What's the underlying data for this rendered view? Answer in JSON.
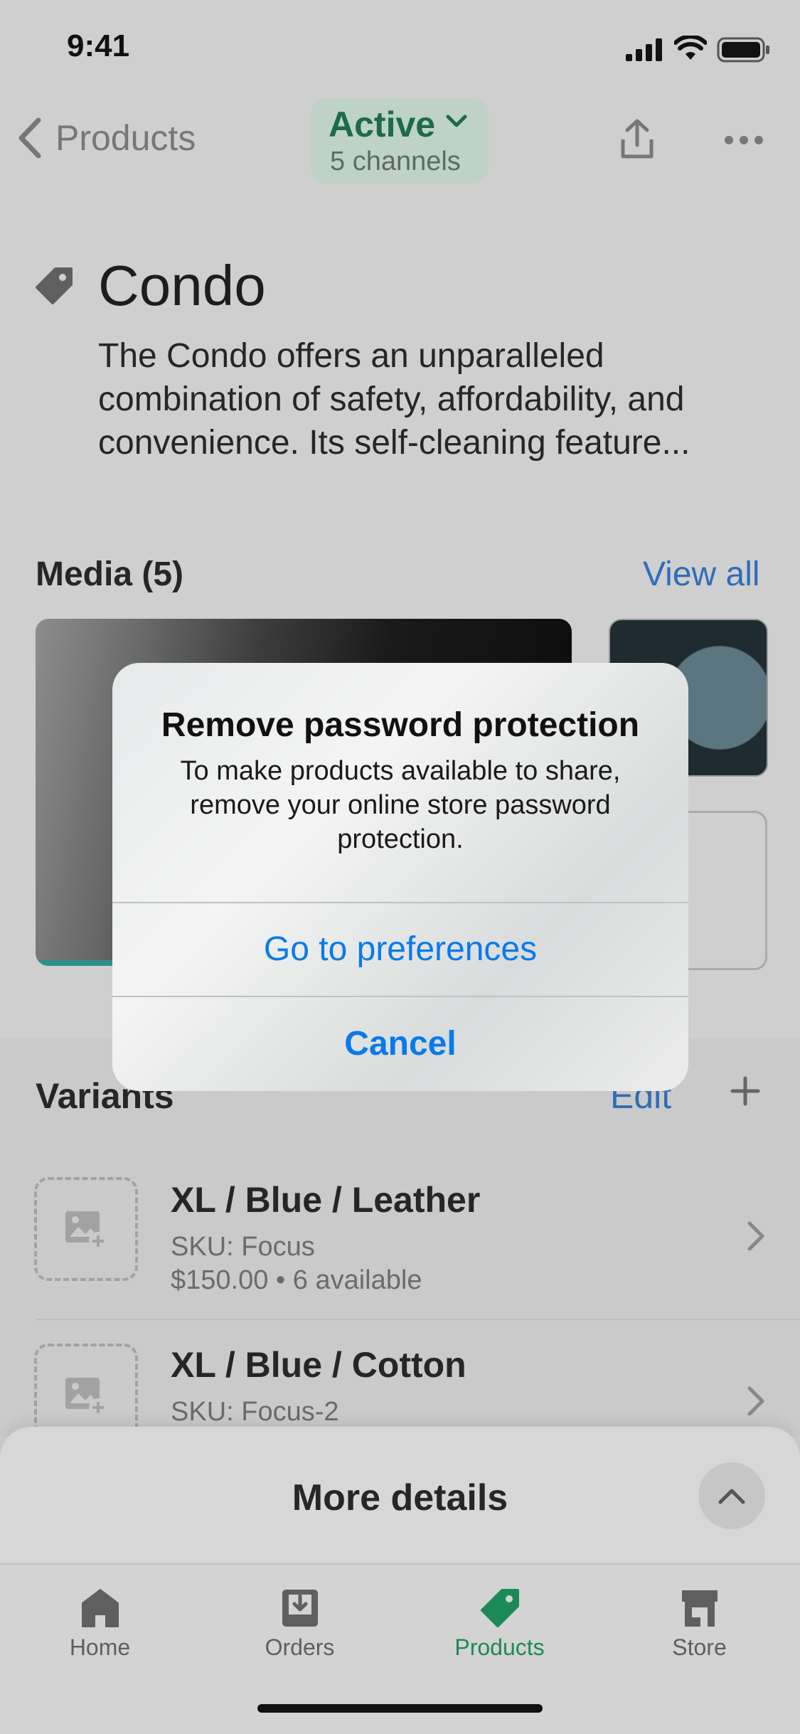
{
  "status_bar": {
    "time": "9:41"
  },
  "nav": {
    "back_label": "Products",
    "status": "Active",
    "channels": "5 channels"
  },
  "product": {
    "title": "Condo",
    "description": "The Condo offers an unparalleled combination of safety, affordability, and convenience. Its self-cleaning feature..."
  },
  "media": {
    "heading": "Media (5)",
    "view_all": "View all"
  },
  "variants": {
    "heading": "Variants",
    "edit": "Edit",
    "items": [
      {
        "name": "XL / Blue / Leather",
        "sku": "SKU: Focus",
        "price_stock": "$150.00 • 6 available"
      },
      {
        "name": "XL / Blue / Cotton",
        "sku": "SKU: Focus-2"
      }
    ]
  },
  "sheet": {
    "title": "More details"
  },
  "tabbar": {
    "items": [
      {
        "label": "Home",
        "icon": "home-icon"
      },
      {
        "label": "Orders",
        "icon": "orders-icon"
      },
      {
        "label": "Products",
        "icon": "tag-icon"
      },
      {
        "label": "Store",
        "icon": "store-icon"
      }
    ],
    "active": "Products"
  },
  "dialog": {
    "title": "Remove password protection",
    "message": "To make products available to share, remove your online store password protection.",
    "primary_button": "Go to preferences",
    "cancel_button": "Cancel"
  },
  "colors": {
    "accent_blue": "#0a7aea",
    "active_green": "#1c6b47",
    "tab_active": "#1c8a56"
  }
}
